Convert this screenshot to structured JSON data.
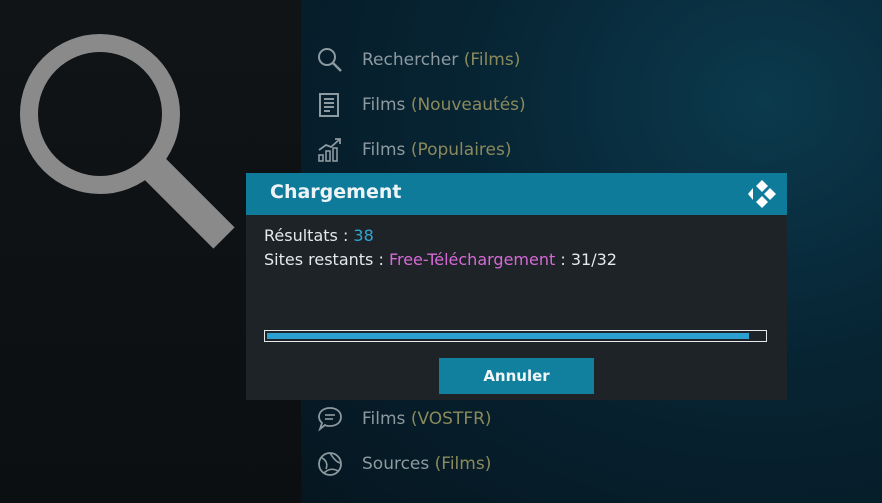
{
  "menu": {
    "items": [
      {
        "icon": "search-icon",
        "label": "Rechercher",
        "sub": "(Films)"
      },
      {
        "icon": "news-icon",
        "label": "Films",
        "sub": "(Nouveautés)"
      },
      {
        "icon": "trending-chart-icon",
        "label": "Films",
        "sub": "(Populaires)"
      },
      {
        "icon": "chat-bubble-icon",
        "label": "Films",
        "sub": "(VOSTFR)"
      },
      {
        "icon": "globe-icon",
        "label": "Sources",
        "sub": "(Films)"
      }
    ]
  },
  "dialog": {
    "title": "Chargement",
    "results_label": "Résultats : ",
    "results_value": "38",
    "sites_label": "Sites restants : ",
    "site_name": "Free-Téléchargement",
    "sites_count": " : 31/32",
    "progress": 0.969,
    "cancel_label": "Annuler"
  },
  "colors": {
    "accent": "#0f7b9a",
    "results_value": "#2fa7d6",
    "site_name": "#d66ad6",
    "menu_sub": "#8b8a5c"
  }
}
